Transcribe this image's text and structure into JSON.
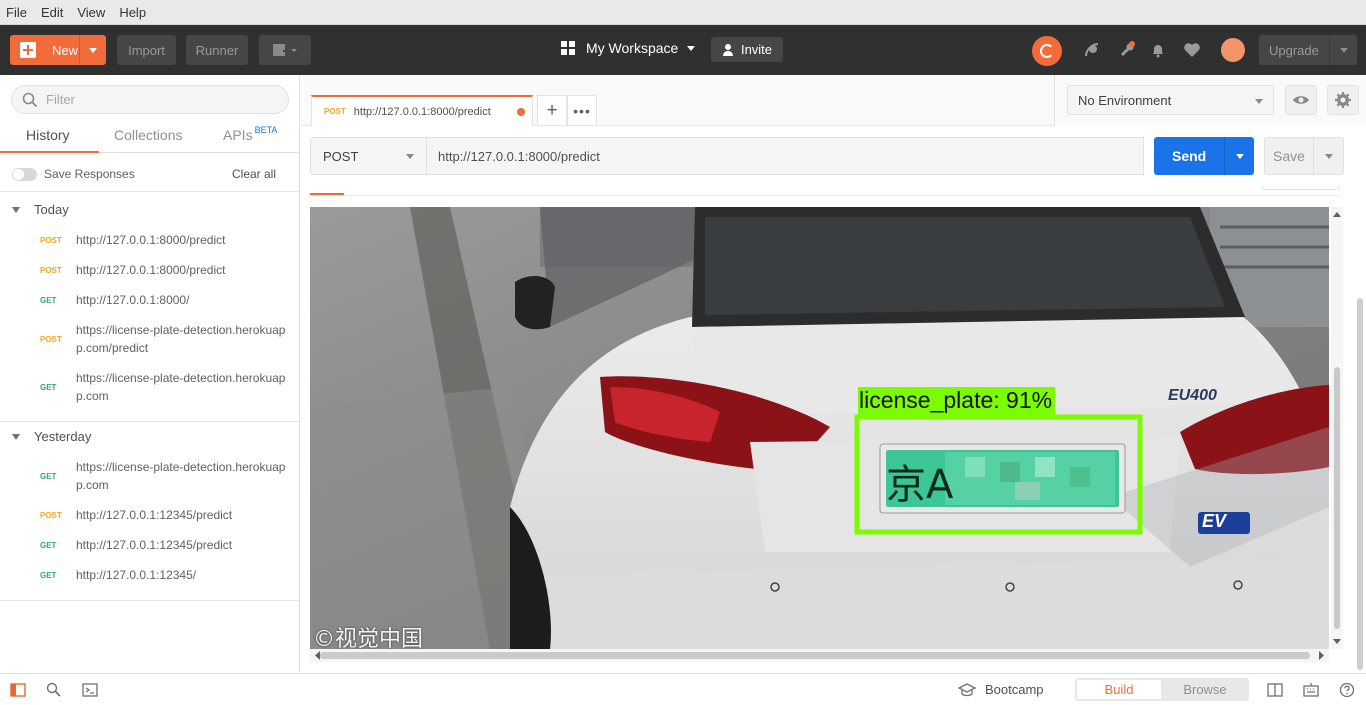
{
  "menu": [
    "File",
    "Edit",
    "View",
    "Help"
  ],
  "header": {
    "new_label": "New",
    "import_label": "Import",
    "runner_label": "Runner",
    "workspace": "My Workspace",
    "invite_label": "Invite",
    "upgrade_label": "Upgrade",
    "accent": "#f26b3a"
  },
  "sidebar": {
    "filter_placeholder": "Filter",
    "tabs": [
      "History",
      "Collections",
      "APIs"
    ],
    "apis_badge": "BETA",
    "save_responses": "Save Responses",
    "clear_all": "Clear all",
    "groups": [
      {
        "name": "Today",
        "items": [
          {
            "method": "POST",
            "url": "http://127.0.0.1:8000/predict"
          },
          {
            "method": "POST",
            "url": "http://127.0.0.1:8000/predict"
          },
          {
            "method": "GET",
            "url": "http://127.0.0.1:8000/"
          },
          {
            "method": "POST",
            "url": "https://license-plate-detection.herokuapp.com/predict"
          },
          {
            "method": "GET",
            "url": "https://license-plate-detection.herokuapp.com"
          }
        ]
      },
      {
        "name": "Yesterday",
        "items": [
          {
            "method": "GET",
            "url": "https://license-plate-detection.herokuapp.com"
          },
          {
            "method": "POST",
            "url": "http://127.0.0.1:12345/predict"
          },
          {
            "method": "GET",
            "url": "http://127.0.0.1:12345/predict"
          },
          {
            "method": "GET",
            "url": "http://127.0.0.1:12345/"
          }
        ]
      }
    ]
  },
  "request_tab": {
    "method": "POST",
    "title": "http://127.0.0.1:8000/predict"
  },
  "environment": {
    "selected": "No Environment"
  },
  "request": {
    "method": "POST",
    "url": "http://127.0.0.1:8000/predict",
    "send_label": "Send",
    "save_label": "Save"
  },
  "response_image": {
    "detection_label": "license_plate: 91%",
    "plate_text": "京A",
    "badge_text": "EU400",
    "ev_text": "EV",
    "watermark": "©视觉中国",
    "box_color": "#7cfc00"
  },
  "footer": {
    "bootcamp_label": "Bootcamp",
    "build_label": "Build",
    "browse_label": "Browse"
  }
}
